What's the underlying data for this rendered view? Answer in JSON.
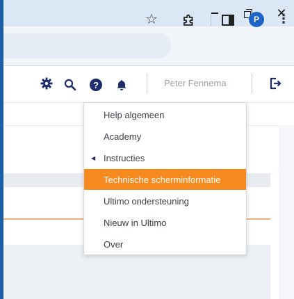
{
  "header": {
    "user_name": "Peter Fennema"
  },
  "browser": {
    "profile_initial": "P"
  },
  "help_menu": {
    "items": [
      {
        "label": "Help algemeen"
      },
      {
        "label": "Academy"
      },
      {
        "label": "Instructies"
      },
      {
        "label": "Technische scherminformatie"
      },
      {
        "label": "Ultimo ondersteuning"
      },
      {
        "label": "Nieuw in Ultimo"
      },
      {
        "label": "Over"
      }
    ],
    "active_index": 3
  },
  "colors": {
    "accent_orange": "#f78a1e",
    "header_icons": "#1f2d6b",
    "profile_blue": "#1e63c6"
  }
}
